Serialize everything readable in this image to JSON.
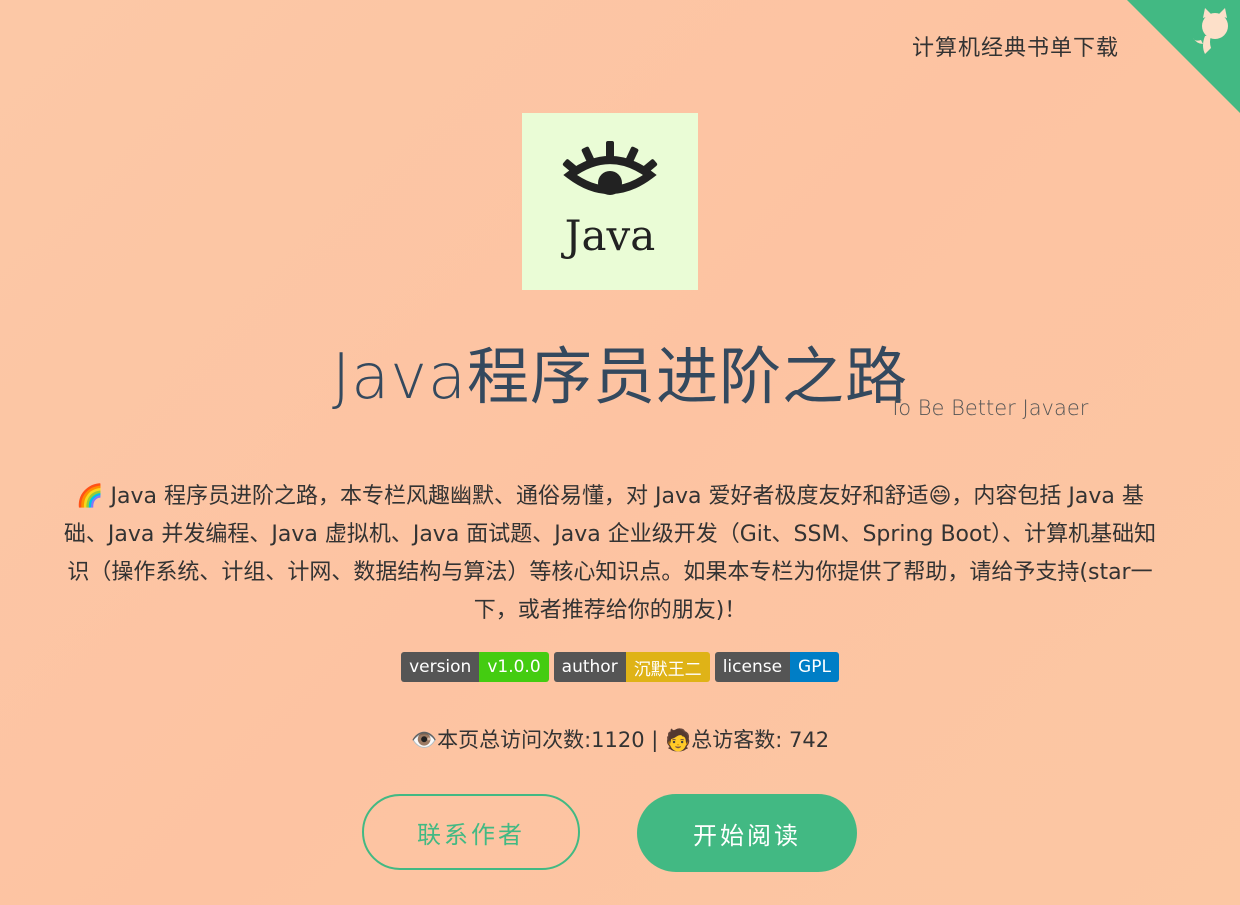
{
  "header": {
    "link_label": "计算机经典书单下载"
  },
  "corner": {
    "icon": "github-octocat-icon",
    "color": "#42b983"
  },
  "logo": {
    "text": "Java",
    "background": "#eafcd6"
  },
  "title": "Java程序员进阶之路",
  "subtitle": "To Be Better Javaer",
  "description": "🌈 Java 程序员进阶之路，本专栏风趣幽默、通俗易懂，对 Java 爱好者极度友好和舒适😄，内容包括 Java 基础、Java 并发编程、Java 虚拟机、Java 面试题、Java 企业级开发（Git、SSM、Spring Boot）、计算机基础知识（操作系统、计组、计网、数据结构与算法）等核心知识点。如果本专栏为你提供了帮助，请给予支持(star一下，或者推荐给你的朋友)！",
  "badges": [
    {
      "key": "version",
      "value": "v1.0.0",
      "color": "#4c1"
    },
    {
      "key": "author",
      "value": "沉默王二",
      "color": "#dfb317"
    },
    {
      "key": "license",
      "value": "GPL",
      "color": "#007ec6"
    }
  ],
  "stats": {
    "visits_label": "👁️本页总访问次数:",
    "visits": "1120",
    "separator": " | ",
    "visitors_label": "🧑总访客数: ",
    "visitors": "742"
  },
  "buttons": {
    "contact": "联系作者",
    "start": "开始阅读"
  }
}
